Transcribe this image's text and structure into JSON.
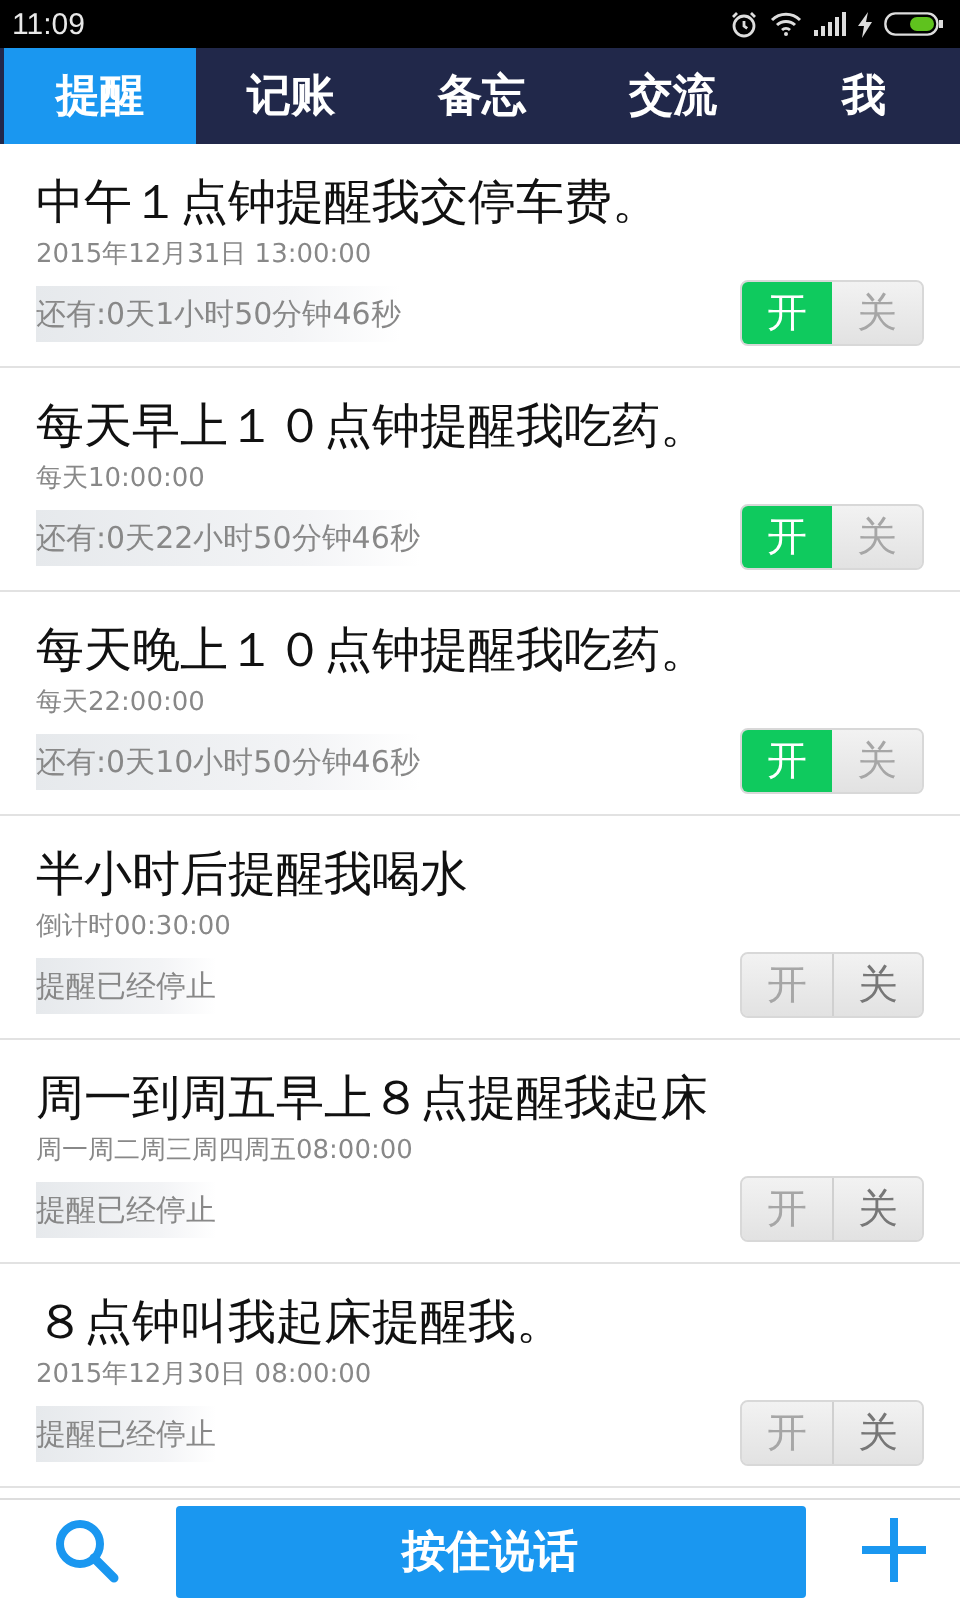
{
  "status_bar": {
    "time": "11:09"
  },
  "tabs": [
    {
      "label": "提醒",
      "selected": true
    },
    {
      "label": "记账",
      "selected": false
    },
    {
      "label": "备忘",
      "selected": false
    },
    {
      "label": "交流",
      "selected": false
    },
    {
      "label": "我",
      "selected": false
    }
  ],
  "reminders": [
    {
      "title": "中午１点钟提醒我交停车费。",
      "schedule": "2015年12月31日 13:00:00",
      "status": "还有:0天1小时50分钟46秒",
      "on": true,
      "on_label": "开",
      "off_label": "关"
    },
    {
      "title": "每天早上１０点钟提醒我吃药。",
      "schedule": "每天10:00:00",
      "status": "还有:0天22小时50分钟46秒",
      "on": true,
      "on_label": "开",
      "off_label": "关"
    },
    {
      "title": "每天晚上１０点钟提醒我吃药。",
      "schedule": "每天22:00:00",
      "status": "还有:0天10小时50分钟46秒",
      "on": true,
      "on_label": "开",
      "off_label": "关"
    },
    {
      "title": "半小时后提醒我喝水",
      "schedule": "倒计时00:30:00",
      "status": "提醒已经停止",
      "on": false,
      "on_label": "开",
      "off_label": "关"
    },
    {
      "title": "周一到周五早上８点提醒我起床",
      "schedule": "周一周二周三周四周五08:00:00",
      "status": "提醒已经停止",
      "on": false,
      "on_label": "开",
      "off_label": "关"
    },
    {
      "title": "８点钟叫我起床提醒我。",
      "schedule": "2015年12月30日 08:00:00",
      "status": "提醒已经停止",
      "on": false,
      "on_label": "开",
      "off_label": "关"
    }
  ],
  "bottom_bar": {
    "talk_button": "按住说话"
  }
}
